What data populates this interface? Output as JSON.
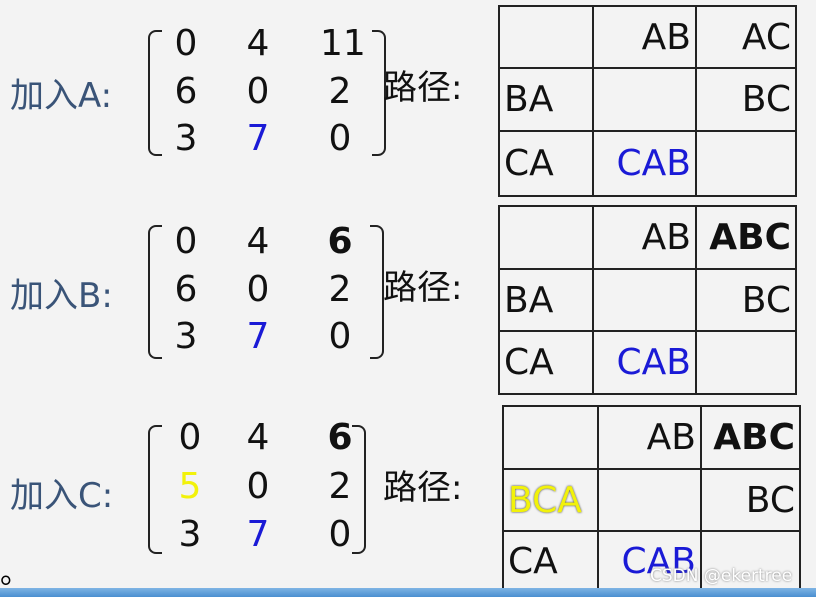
{
  "path_label": "路径:",
  "colors": {
    "label": "#3a5478",
    "blue": "#1a1ad6",
    "yellow": "#f2f20a",
    "text": "#111111"
  },
  "steps": [
    {
      "label": "加入A:",
      "matrix": [
        [
          "0",
          "4",
          "11"
        ],
        [
          "6",
          "0",
          "2"
        ],
        [
          "3",
          "7",
          "0"
        ]
      ],
      "highlights": {
        "2-1": "blue"
      },
      "paths": [
        [
          "",
          "AB",
          "AC"
        ],
        [
          "BA",
          "",
          "BC"
        ],
        [
          "CA",
          "CAB",
          ""
        ]
      ],
      "path_styles": {
        "2-1": "blue"
      }
    },
    {
      "label": "加入B:",
      "matrix": [
        [
          "0",
          "4",
          "6"
        ],
        [
          "6",
          "0",
          "2"
        ],
        [
          "3",
          "7",
          "0"
        ]
      ],
      "highlights": {
        "2-1": "blue",
        "0-2": "bold"
      },
      "paths": [
        [
          "",
          "AB",
          "ABC"
        ],
        [
          "BA",
          "",
          "BC"
        ],
        [
          "CA",
          "CAB",
          ""
        ]
      ],
      "path_styles": {
        "2-1": "blue",
        "0-2": "bold"
      }
    },
    {
      "label": "加入C:",
      "matrix": [
        [
          "0",
          "4",
          "6"
        ],
        [
          "5",
          "0",
          "2"
        ],
        [
          "3",
          "7",
          "0"
        ]
      ],
      "highlights": {
        "2-1": "blue",
        "0-2": "bold",
        "1-0": "yellow"
      },
      "paths": [
        [
          "",
          "AB",
          "ABC"
        ],
        [
          "BCA",
          "",
          "BC"
        ],
        [
          "CA",
          "CAB",
          ""
        ]
      ],
      "path_styles": {
        "2-1": "blue",
        "0-2": "bold",
        "1-0": "yellow"
      }
    }
  ],
  "trailing_mark": "。",
  "watermark": "CSDN @ekertree"
}
